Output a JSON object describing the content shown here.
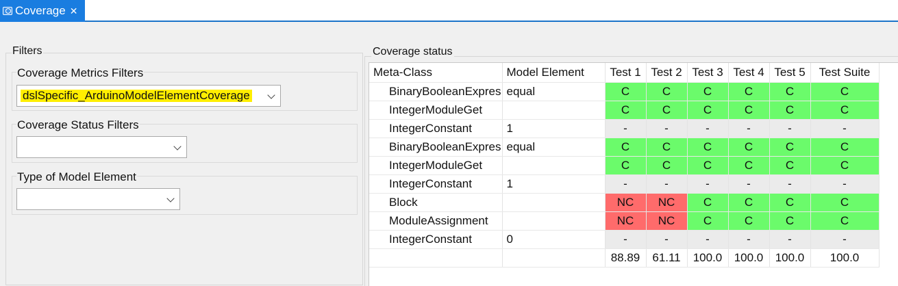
{
  "tab": {
    "label": "Coverage",
    "close": "✕"
  },
  "filters": {
    "title": "Filters",
    "metrics": {
      "title": "Coverage Metrics Filters",
      "value": "dslSpecific_ArduinoModelElementCoverage"
    },
    "status": {
      "title": "Coverage Status Filters",
      "value": ""
    },
    "type": {
      "title": "Type of Model Element",
      "value": ""
    }
  },
  "coverage": {
    "title": "Coverage status",
    "columns": [
      "Meta-Class",
      "Model Element",
      "Test 1",
      "Test 2",
      "Test 3",
      "Test 4",
      "Test 5",
      "Test Suite"
    ],
    "rows": [
      {
        "meta": "BinaryBooleanExpres",
        "element": "equal",
        "cells": [
          "C",
          "C",
          "C",
          "C",
          "C",
          "C"
        ]
      },
      {
        "meta": "IntegerModuleGet",
        "element": "",
        "cells": [
          "C",
          "C",
          "C",
          "C",
          "C",
          "C"
        ]
      },
      {
        "meta": "IntegerConstant",
        "element": "1",
        "cells": [
          "-",
          "-",
          "-",
          "-",
          "-",
          "-"
        ]
      },
      {
        "meta": "BinaryBooleanExpres",
        "element": "equal",
        "cells": [
          "C",
          "C",
          "C",
          "C",
          "C",
          "C"
        ]
      },
      {
        "meta": "IntegerModuleGet",
        "element": "",
        "cells": [
          "C",
          "C",
          "C",
          "C",
          "C",
          "C"
        ]
      },
      {
        "meta": "IntegerConstant",
        "element": "1",
        "cells": [
          "-",
          "-",
          "-",
          "-",
          "-",
          "-"
        ]
      },
      {
        "meta": "Block",
        "element": "",
        "cells": [
          "NC",
          "NC",
          "C",
          "C",
          "C",
          "C"
        ]
      },
      {
        "meta": "ModuleAssignment",
        "element": "",
        "cells": [
          "NC",
          "NC",
          "C",
          "C",
          "C",
          "C"
        ]
      },
      {
        "meta": "IntegerConstant",
        "element": "0",
        "cells": [
          "-",
          "-",
          "-",
          "-",
          "-",
          "-"
        ]
      }
    ],
    "totals": [
      "88.89",
      "61.11",
      "100.0",
      "100.0",
      "100.0",
      "100.0"
    ],
    "status_colors": {
      "C": "#6bfb6b",
      "NC": "#ff6b6b",
      "-": "#ebebeb"
    }
  }
}
